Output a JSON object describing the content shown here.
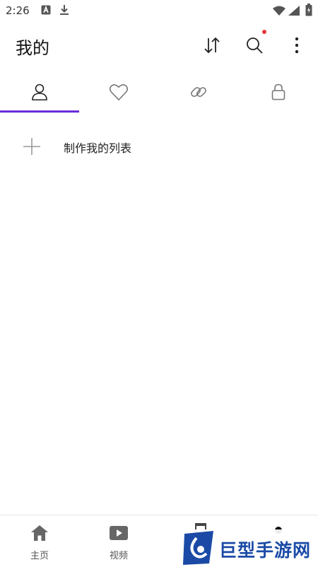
{
  "status_bar": {
    "time": "2:26",
    "icons": [
      "notification-a-icon",
      "download-icon",
      "wifi-icon",
      "signal-icon",
      "battery-icon"
    ]
  },
  "header": {
    "title": "我的",
    "actions": [
      "sort-icon",
      "search-icon",
      "more-icon"
    ],
    "search_badge_color": "#e53935"
  },
  "tabs": {
    "items": [
      "person-icon",
      "heart-icon",
      "link-icon",
      "lock-icon"
    ],
    "selected_index": 0,
    "accent_color": "#6a2cd8"
  },
  "create": {
    "label": "制作我的列表"
  },
  "bottom_nav": {
    "items": [
      {
        "label": "主页",
        "icon": "home-icon"
      },
      {
        "label": "视频",
        "icon": "video-icon"
      },
      {
        "label": "",
        "icon": "music-icon"
      },
      {
        "label": "",
        "icon": "profile-dot-icon"
      }
    ]
  },
  "watermark": {
    "text": "巨型手游网",
    "color": "#1a4aa6"
  }
}
